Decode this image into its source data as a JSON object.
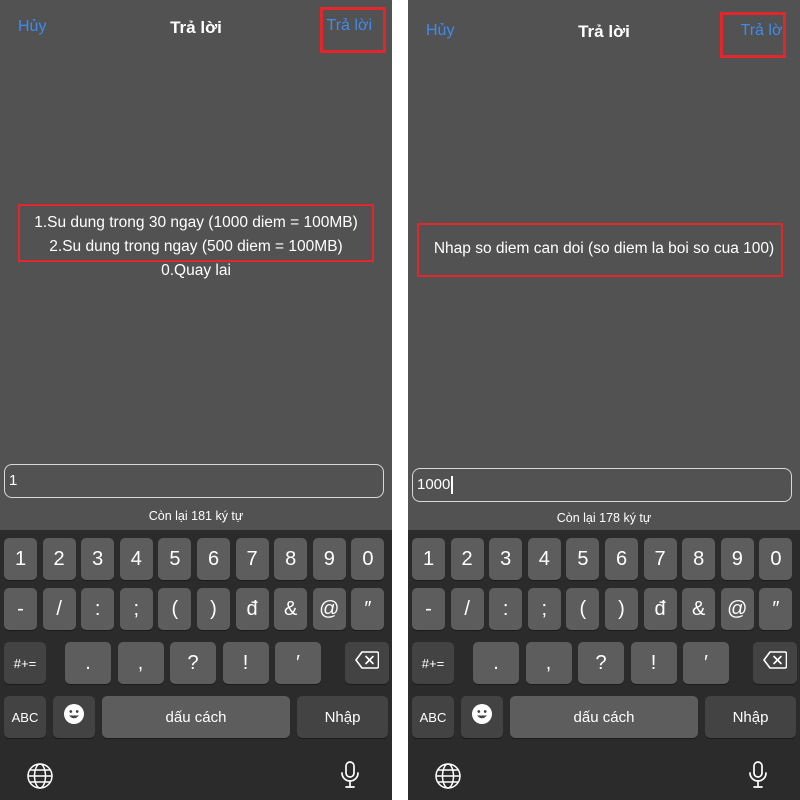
{
  "panels": [
    {
      "nav": {
        "cancel": "Hủy",
        "title": "Trả lời",
        "reply": "Trả lời"
      },
      "message": [
        "1.Su dung trong 30 ngay (1000 diem = 100MB)",
        "2.Su dung trong ngay (500 diem = 100MB)",
        "0.Quay lai"
      ],
      "input_value": "1",
      "counter": "Còn lại 181 ký tự"
    },
    {
      "nav": {
        "cancel": "Hủy",
        "title": "Trả lời",
        "reply": "Trả lời"
      },
      "message": [
        "Nhap so diem can doi (so diem la boi so cua 100)"
      ],
      "input_value": "1000",
      "counter": "Còn lại 178 ký tự"
    }
  ],
  "keyboard": {
    "row1": [
      "1",
      "2",
      "3",
      "4",
      "5",
      "6",
      "7",
      "8",
      "9",
      "0"
    ],
    "row2": [
      "-",
      "/",
      ":",
      ";",
      "(",
      ")",
      "đ",
      "&",
      "@",
      "″"
    ],
    "row3_symbols_key": "#+=",
    "row3": [
      ".",
      ",",
      "?",
      "!",
      "′"
    ],
    "abc_key": "ABC",
    "space_key": "dấu cách",
    "return_key": "Nhập",
    "icons": {
      "backspace": "backspace-icon",
      "emoji": "emoji-icon",
      "globe": "globe-icon",
      "mic": "microphone-icon"
    }
  },
  "colors": {
    "background": "#525252",
    "keyboard": "#2b2b2b",
    "key": "#5d5d5d",
    "key_dark": "#434343",
    "accent": "#3d8bf0",
    "highlight": "#e3262b"
  }
}
